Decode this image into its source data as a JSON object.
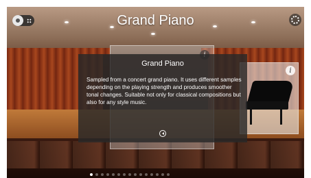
{
  "header": {
    "title": "Grand Piano",
    "view_toggle": [
      "list-icon",
      "grid-icon"
    ],
    "settings_icon": "gear-icon"
  },
  "info_panel": {
    "title": "Grand Piano",
    "description": "Sampled from a concert grand piano. It uses different samples depending on the playing strength and produces smoother tonal changes. Suitable not only for classical compositions but also for any style music.",
    "play_icon": "play-back-icon",
    "info_icon": "info-icon"
  },
  "pager": {
    "count": 15,
    "active_index": 0
  }
}
